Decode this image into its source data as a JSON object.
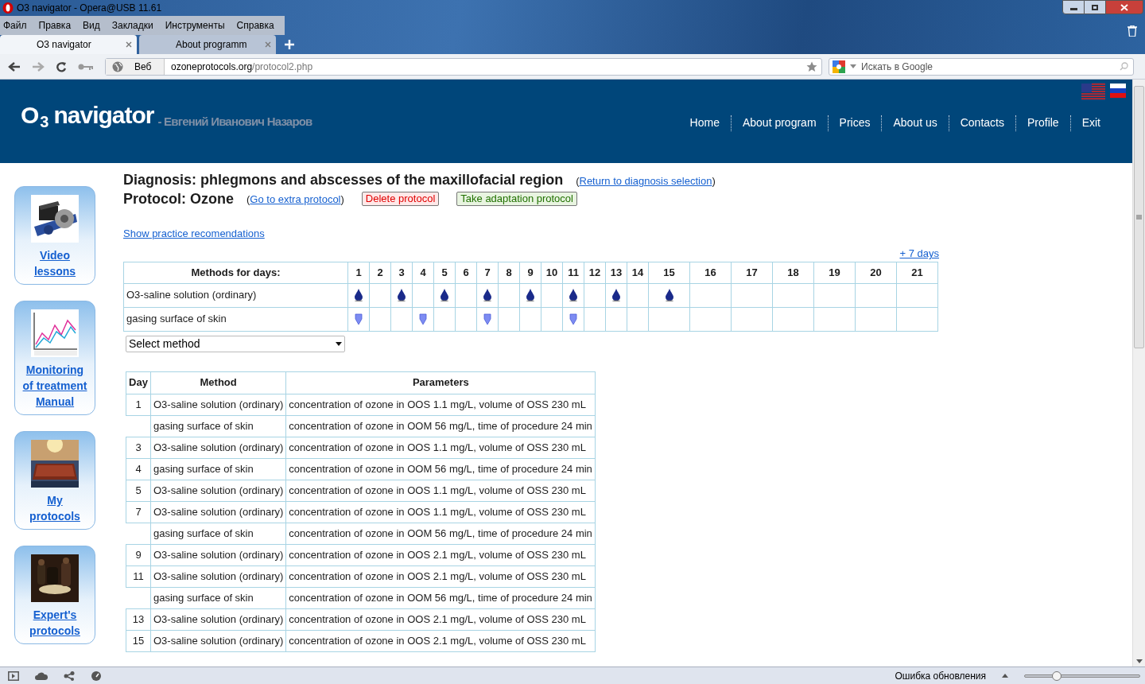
{
  "window": {
    "title": "O3 navigator - Opera@USB 11.61"
  },
  "menu": [
    "Файл",
    "Правка",
    "Вид",
    "Закладки",
    "Инструменты",
    "Справка"
  ],
  "tabs": [
    {
      "label": "O3 navigator",
      "selected": true
    },
    {
      "label": "About programm",
      "selected": false
    }
  ],
  "address": {
    "mode": "Веб",
    "domain": "ozoneprotocols.org",
    "path": "/protocol2.php"
  },
  "search": {
    "placeholder": "Искать в Google"
  },
  "site": {
    "logo": {
      "letter": "O",
      "subscript": "3",
      "word": "navigator"
    },
    "author": "- Евгений Иванович Назаров",
    "nav": [
      "Home",
      "About program",
      "Prices",
      "About us",
      "Contacts",
      "Profile",
      "Exit"
    ]
  },
  "sidebar": [
    {
      "label": "Video lessons"
    },
    {
      "label": "Monitoring of treatment Manual"
    },
    {
      "label": "My protocols"
    },
    {
      "label": "Expert's protocols"
    }
  ],
  "diagnosis": {
    "text": "Diagnosis: phlegmons and abscesses of the maxillofacial region",
    "link": {
      "open": "(",
      "label": "Return to diagnosis selection",
      "close": ")"
    }
  },
  "protocol": {
    "text": "Protocol: Ozone",
    "link": {
      "open": "(",
      "label": "Go to extra protocol",
      "close": ")"
    },
    "buttons": [
      {
        "label": "Delete protocol",
        "kind": "danger"
      },
      {
        "label": "Take adaptation protocol",
        "kind": "success"
      }
    ]
  },
  "recommendations_link": "Show practice recomendations",
  "schedule": {
    "more_link": "+ 7 days",
    "header": "Methods for days:",
    "days": [
      "1",
      "2",
      "3",
      "4",
      "5",
      "6",
      "7",
      "8",
      "9",
      "10",
      "11",
      "12",
      "13",
      "14",
      "15",
      "16",
      "17",
      "18",
      "19",
      "20",
      "21"
    ],
    "rows": [
      {
        "method": "O3-saline solution (ordinary)",
        "kind": "drop",
        "days": [
          true,
          false,
          true,
          false,
          true,
          false,
          true,
          false,
          true,
          false,
          true,
          false,
          true,
          false,
          true,
          false,
          false,
          false,
          false,
          false,
          false
        ]
      },
      {
        "method": "gasing surface of skin",
        "kind": "gas",
        "days": [
          true,
          false,
          false,
          true,
          false,
          false,
          true,
          false,
          false,
          false,
          true,
          false,
          false,
          false,
          false,
          false,
          false,
          false,
          false,
          false,
          false
        ]
      }
    ]
  },
  "method_select": {
    "value": "Select method"
  },
  "plan": {
    "columns": [
      "Day",
      "Method",
      "Parameters"
    ],
    "rows": [
      {
        "day": "1",
        "method": "O3-saline solution (ordinary)",
        "parameters": "concentration of ozone in OOS 1.1 mg/L, volume of OSS 230 mL"
      },
      {
        "method": "gasing surface of skin",
        "parameters": "concentration of ozone in OOM 56 mg/L, time of procedure 24 min"
      },
      {
        "day": "3",
        "method": "O3-saline solution (ordinary)",
        "parameters": "concentration of ozone in OOS 1.1 mg/L, volume of OSS 230 mL"
      },
      {
        "day": "4",
        "method": "gasing surface of skin",
        "parameters": "concentration of ozone in OOM 56 mg/L, time of procedure 24 min"
      },
      {
        "day": "5",
        "method": "O3-saline solution (ordinary)",
        "parameters": "concentration of ozone in OOS 1.1 mg/L, volume of OSS 230 mL"
      },
      {
        "day": "7",
        "method": "O3-saline solution (ordinary)",
        "parameters": "concentration of ozone in OOS 1.1 mg/L, volume of OSS 230 mL"
      },
      {
        "method": "gasing surface of skin",
        "parameters": "concentration of ozone in OOM 56 mg/L, time of procedure 24 min"
      },
      {
        "day": "9",
        "method": "O3-saline solution (ordinary)",
        "parameters": "concentration of ozone in OOS 2.1 mg/L, volume of OSS 230 mL"
      },
      {
        "day": "11",
        "method": "O3-saline solution (ordinary)",
        "parameters": "concentration of ozone in OOS 2.1 mg/L, volume of OSS 230 mL"
      },
      {
        "method": "gasing surface of skin",
        "parameters": "concentration of ozone in OOM 56 mg/L, time of procedure 24 min"
      },
      {
        "day": "13",
        "method": "O3-saline solution (ordinary)",
        "parameters": "concentration of ozone in OOS 2.1 mg/L, volume of OSS 230 mL"
      },
      {
        "day": "15",
        "method": "O3-saline solution (ordinary)",
        "parameters": "concentration of ozone in OOS 2.1 mg/L, volume of OSS 230 mL"
      }
    ]
  },
  "status_bar": {
    "text": "Ошибка обновления",
    "zoom": {
      "level": 0.28
    }
  }
}
